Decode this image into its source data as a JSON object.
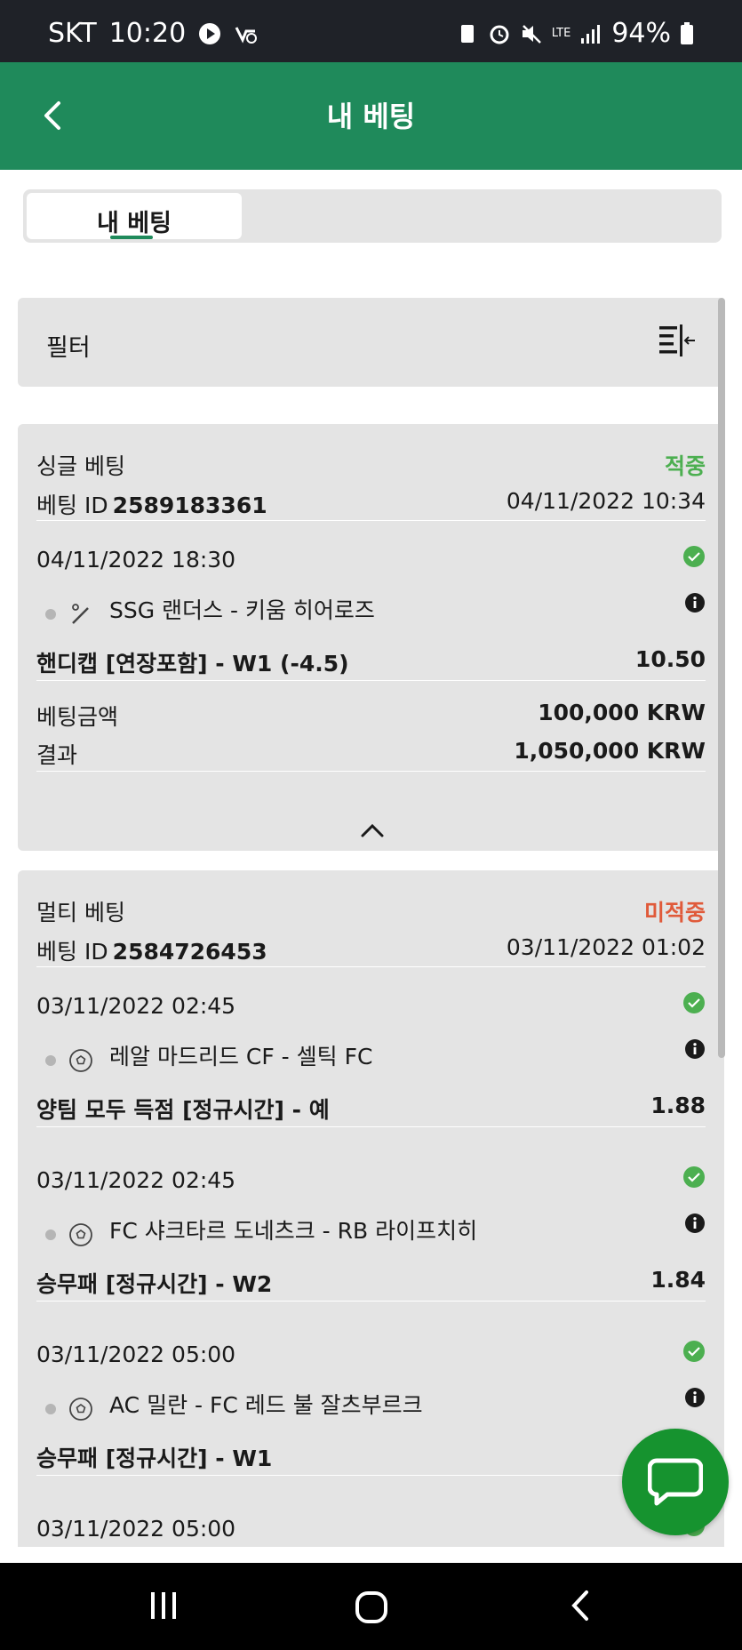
{
  "status_bar": {
    "carrier": "SKT",
    "time": "10:20",
    "battery": "94%",
    "network": "LTE"
  },
  "app_bar": {
    "title": "내 베팅"
  },
  "tabs": [
    {
      "label": "내 베팅",
      "active": true
    }
  ],
  "filter": {
    "label": "필터"
  },
  "colors": {
    "brand": "#1f8a5b",
    "won": "#4caf50",
    "lost": "#e05a3a",
    "fab": "#16932f"
  },
  "bets": [
    {
      "type": "싱글 베팅",
      "status": "적중",
      "id_label": "베팅 ID",
      "id": "2589183361",
      "datetime": "04/11/2022 10:34",
      "selections": [
        {
          "datetime": "04/11/2022 18:30",
          "sport_icon": "baseball-icon",
          "match": "SSG 랜더스 - 키움 히어로즈",
          "market": "핸디캡 [연장포함] - W1 (-4.5)",
          "odds": "10.50"
        }
      ],
      "stake_label": "베팅금액",
      "stake": "100,000 KRW",
      "result_label": "결과",
      "result": "1,050,000 KRW"
    },
    {
      "type": "멀티 베팅",
      "status": "미적중",
      "id_label": "베팅 ID",
      "id": "2584726453",
      "datetime": "03/11/2022 01:02",
      "selections": [
        {
          "datetime": "03/11/2022 02:45",
          "sport_icon": "soccer-ball-icon",
          "match": "레알 마드리드 CF - 셀틱 FC",
          "market": "양팀 모두 득점 [정규시간] - 예",
          "odds": "1.88"
        },
        {
          "datetime": "03/11/2022 02:45",
          "sport_icon": "soccer-ball-icon",
          "match": "FC 샤크타르 도네츠크 - RB 라이프치히",
          "market": "승무패 [정규시간] - W2",
          "odds": "1.84"
        },
        {
          "datetime": "03/11/2022 05:00",
          "sport_icon": "soccer-ball-icon",
          "match": "AC 밀란 - FC 레드 불 잘츠부르크",
          "market": "승무패 [정규시간] - W1",
          "odds": ""
        },
        {
          "datetime": "03/11/2022 05:00"
        }
      ]
    }
  ]
}
